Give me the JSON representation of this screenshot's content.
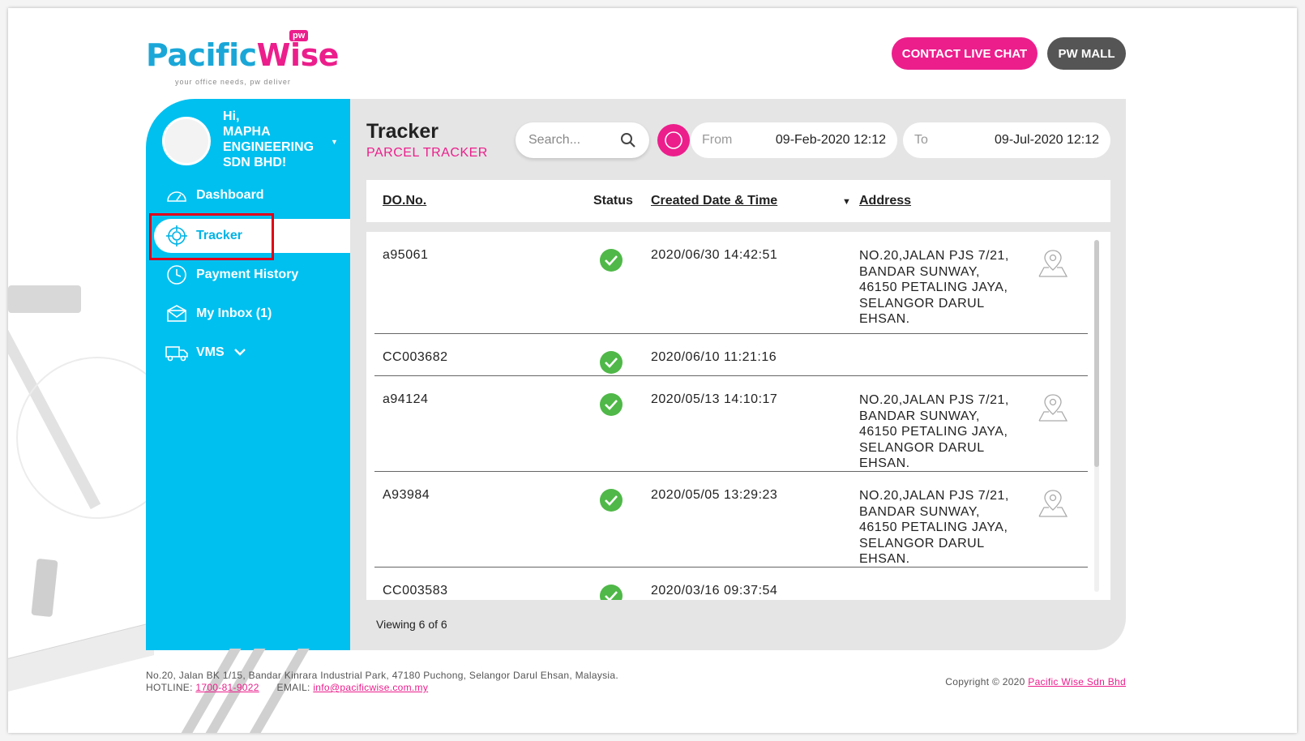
{
  "brand": {
    "name_part1": "Pac",
    "name_mid": "i",
    "name_part2": "fic",
    "name_part3": "Wise",
    "badge": "pw",
    "tagline": "your office needs, pw deliver",
    "primary_color": "#00c0f0",
    "accent_color": "#ec1e8c"
  },
  "header": {
    "contact_label": "CONTACT LIVE CHAT",
    "mall_label": "PW MALL"
  },
  "sidebar": {
    "greeting": "Hi,",
    "company": "MAPHA ENGINEERING SDN BHD!",
    "items": [
      {
        "label": "Dashboard",
        "icon": "speedometer-icon"
      },
      {
        "label": "Tracker",
        "icon": "crosshair-icon"
      },
      {
        "label": "Payment History",
        "icon": "clock-icon"
      },
      {
        "label": "My Inbox (1)",
        "icon": "envelope-icon"
      },
      {
        "label": "VMS",
        "icon": "truck-icon"
      }
    ]
  },
  "main": {
    "title": "Tracker",
    "subtitle": "PARCEL TRACKER",
    "search_placeholder": "Search...",
    "from_label": "From",
    "from_value": "09-Feb-2020 12:12",
    "to_label": "To",
    "to_value": "09-Jul-2020 12:12",
    "columns": {
      "do_no": "DO.No.",
      "status": "Status",
      "created": "Created Date & Time",
      "sort_arrow": "▼",
      "address": "Address"
    },
    "rows": [
      {
        "do_no": "a95061",
        "status": "delivered",
        "created": "2020/06/30 14:42:51",
        "address": "NO.20,JALAN PJS 7/21, BANDAR SUNWAY, 46150 PETALING JAYA, SELANGOR DARUL EHSAN."
      },
      {
        "do_no": "CC003682",
        "status": "delivered",
        "created": "2020/06/10 11:21:16",
        "address": ""
      },
      {
        "do_no": "a94124",
        "status": "delivered",
        "created": "2020/05/13 14:10:17",
        "address": "NO.20,JALAN PJS 7/21, BANDAR SUNWAY, 46150 PETALING JAYA, SELANGOR DARUL EHSAN."
      },
      {
        "do_no": "A93984",
        "status": "delivered",
        "created": "2020/05/05 13:29:23",
        "address": "NO.20,JALAN PJS 7/21, BANDAR SUNWAY, 46150 PETALING JAYA, SELANGOR DARUL EHSAN."
      },
      {
        "do_no": "CC003583",
        "status": "delivered",
        "created": "2020/03/16 09:37:54",
        "address": ""
      }
    ],
    "viewing": "Viewing 6 of 6"
  },
  "footer": {
    "address": "No.20, Jalan BK 1/15, Bandar Kinrara Industrial Park, 47180 Puchong, Selangor Darul Ehsan, Malaysia.",
    "hotline_label": "HOTLINE:",
    "hotline": "1700-81-9022",
    "email_label": "EMAIL:",
    "email": "info@pacificwise.com.my",
    "copyright": "Copyright © 2020",
    "company_link": "Pacific Wise Sdn Bhd"
  }
}
